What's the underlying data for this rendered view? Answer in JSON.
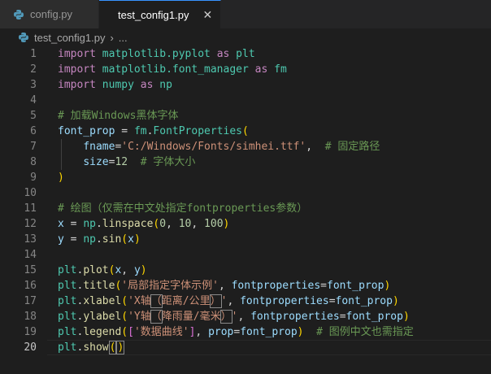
{
  "tabs": [
    {
      "label": "config.py",
      "active": false
    },
    {
      "label": "test_config1.py",
      "active": true
    }
  ],
  "tab_close_glyph": "✕",
  "breadcrumb": {
    "file": "test_config1.py",
    "separator": "›",
    "more": "..."
  },
  "editor": {
    "current_line": 20,
    "line_numbers": [
      "1",
      "2",
      "3",
      "4",
      "5",
      "6",
      "7",
      "8",
      "9",
      "10",
      "11",
      "12",
      "13",
      "14",
      "15",
      "16",
      "17",
      "18",
      "19",
      "20"
    ],
    "lines": [
      [
        [
          "kw",
          "import"
        ],
        [
          "op",
          " "
        ],
        [
          "mod",
          "matplotlib.pyplot"
        ],
        [
          "op",
          " "
        ],
        [
          "kw",
          "as"
        ],
        [
          "op",
          " "
        ],
        [
          "mod",
          "plt"
        ]
      ],
      [
        [
          "kw",
          "import"
        ],
        [
          "op",
          " "
        ],
        [
          "mod",
          "matplotlib.font_manager"
        ],
        [
          "op",
          " "
        ],
        [
          "kw",
          "as"
        ],
        [
          "op",
          " "
        ],
        [
          "mod",
          "fm"
        ]
      ],
      [
        [
          "kw",
          "import"
        ],
        [
          "op",
          " "
        ],
        [
          "mod",
          "numpy"
        ],
        [
          "op",
          " "
        ],
        [
          "kw",
          "as"
        ],
        [
          "op",
          " "
        ],
        [
          "mod",
          "np"
        ]
      ],
      [],
      [
        [
          "com",
          "# 加载Windows黑体字体"
        ]
      ],
      [
        [
          "var",
          "font_prop"
        ],
        [
          "op",
          " = "
        ],
        [
          "mod",
          "fm"
        ],
        [
          "op",
          "."
        ],
        [
          "mod",
          "FontProperties"
        ],
        [
          "p1",
          "("
        ]
      ],
      [
        [
          "op",
          "    "
        ],
        [
          "var",
          "fname"
        ],
        [
          "op",
          "="
        ],
        [
          "str",
          "'C:/Windows/Fonts/simhei.ttf'"
        ],
        [
          "op",
          ",  "
        ],
        [
          "com",
          "# 固定路径"
        ]
      ],
      [
        [
          "op",
          "    "
        ],
        [
          "var",
          "size"
        ],
        [
          "op",
          "="
        ],
        [
          "num",
          "12"
        ],
        [
          "op",
          "  "
        ],
        [
          "com",
          "# 字体大小"
        ]
      ],
      [
        [
          "p1",
          ")"
        ]
      ],
      [],
      [
        [
          "com",
          "# 绘图（仅需在中文处指定fontproperties参数）"
        ]
      ],
      [
        [
          "var",
          "x"
        ],
        [
          "op",
          " = "
        ],
        [
          "mod",
          "np"
        ],
        [
          "op",
          "."
        ],
        [
          "fn",
          "linspace"
        ],
        [
          "p1",
          "("
        ],
        [
          "num",
          "0"
        ],
        [
          "op",
          ", "
        ],
        [
          "num",
          "10"
        ],
        [
          "op",
          ", "
        ],
        [
          "num",
          "100"
        ],
        [
          "p1",
          ")"
        ]
      ],
      [
        [
          "var",
          "y"
        ],
        [
          "op",
          " = "
        ],
        [
          "mod",
          "np"
        ],
        [
          "op",
          "."
        ],
        [
          "fn",
          "sin"
        ],
        [
          "p1",
          "("
        ],
        [
          "var",
          "x"
        ],
        [
          "p1",
          ")"
        ]
      ],
      [],
      [
        [
          "mod",
          "plt"
        ],
        [
          "op",
          "."
        ],
        [
          "fn",
          "plot"
        ],
        [
          "p1",
          "("
        ],
        [
          "var",
          "x"
        ],
        [
          "op",
          ", "
        ],
        [
          "var",
          "y"
        ],
        [
          "p1",
          ")"
        ]
      ],
      [
        [
          "mod",
          "plt"
        ],
        [
          "op",
          "."
        ],
        [
          "fn",
          "title"
        ],
        [
          "p1",
          "("
        ],
        [
          "str",
          "'局部指定字体示例'"
        ],
        [
          "op",
          ", "
        ],
        [
          "var",
          "fontproperties"
        ],
        [
          "op",
          "="
        ],
        [
          "var",
          "font_prop"
        ],
        [
          "p1",
          ")"
        ]
      ],
      [
        [
          "mod",
          "plt"
        ],
        [
          "op",
          "."
        ],
        [
          "fn",
          "xlabel"
        ],
        [
          "p1",
          "("
        ],
        [
          "str",
          "'X轴"
        ],
        [
          "strhl",
          "（"
        ],
        [
          "str",
          "距离/公里"
        ],
        [
          "strhl",
          "）"
        ],
        [
          "str",
          "'"
        ],
        [
          "op",
          ", "
        ],
        [
          "var",
          "fontproperties"
        ],
        [
          "op",
          "="
        ],
        [
          "var",
          "font_prop"
        ],
        [
          "p1",
          ")"
        ]
      ],
      [
        [
          "mod",
          "plt"
        ],
        [
          "op",
          "."
        ],
        [
          "fn",
          "ylabel"
        ],
        [
          "p1",
          "("
        ],
        [
          "str",
          "'Y轴"
        ],
        [
          "strhl",
          "（"
        ],
        [
          "str",
          "降雨量/毫米"
        ],
        [
          "strhl",
          "）"
        ],
        [
          "str",
          "'"
        ],
        [
          "op",
          ", "
        ],
        [
          "var",
          "fontproperties"
        ],
        [
          "op",
          "="
        ],
        [
          "var",
          "font_prop"
        ],
        [
          "p1",
          ")"
        ]
      ],
      [
        [
          "mod",
          "plt"
        ],
        [
          "op",
          "."
        ],
        [
          "fn",
          "legend"
        ],
        [
          "p1",
          "("
        ],
        [
          "p2",
          "["
        ],
        [
          "str",
          "'数据曲线'"
        ],
        [
          "p2",
          "]"
        ],
        [
          "op",
          ", "
        ],
        [
          "var",
          "prop"
        ],
        [
          "op",
          "="
        ],
        [
          "var",
          "font_prop"
        ],
        [
          "p1",
          ")"
        ],
        [
          "op",
          "  "
        ],
        [
          "com",
          "# 图例中文也需指定"
        ]
      ],
      [
        [
          "mod",
          "plt"
        ],
        [
          "op",
          "."
        ],
        [
          "fn",
          "show"
        ],
        [
          "p1br",
          "("
        ],
        [
          "p1br",
          ")"
        ]
      ]
    ]
  },
  "icons": {
    "python_file": "python-file-icon",
    "close": "close-icon",
    "chevron": "chevron-right-icon"
  },
  "colors": {
    "keyword": "#c586c0",
    "module": "#4ec9b0",
    "variable": "#9cdcfe",
    "function": "#dcdcaa",
    "string": "#ce9178",
    "number": "#b5cea8",
    "comment": "#6a9955",
    "active_tab_border": "#3794ff",
    "python_icon": "#519aba"
  }
}
